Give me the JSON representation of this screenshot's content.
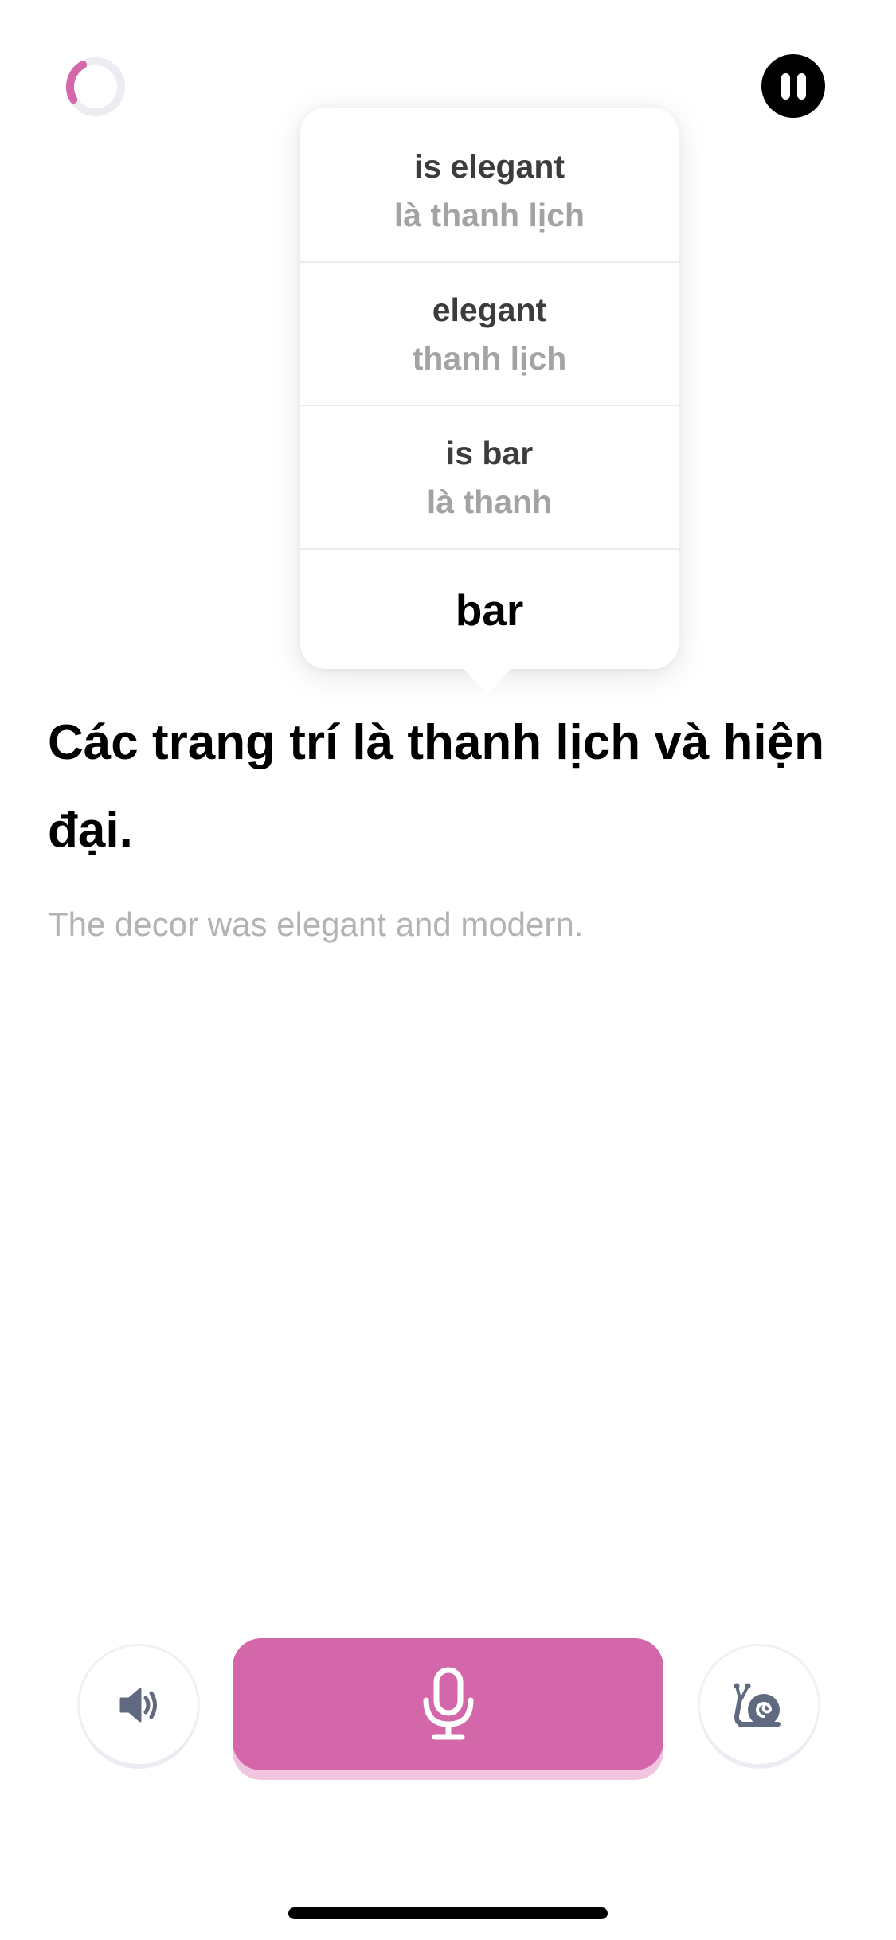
{
  "lesson": {
    "progress_fraction": 0.25
  },
  "popover": {
    "options": [
      {
        "main": "is elegant",
        "sub": "là thanh lịch"
      },
      {
        "main": "elegant",
        "sub": "thanh lịch"
      },
      {
        "main": "is bar",
        "sub": "là thanh"
      },
      {
        "main": "bar"
      }
    ]
  },
  "sentence": {
    "text": "Các trang trí là thanh lịch và hiện đại.",
    "translation": "The decor was elegant and modern."
  },
  "colors": {
    "accent": "#d467a9",
    "accent_light": "#f1c5df",
    "icon_gray": "#5f6a80",
    "track": "#ececf2"
  },
  "icons": [
    "progress-ring-icon",
    "pause-icon",
    "speaker-icon",
    "microphone-icon",
    "snail-icon"
  ]
}
